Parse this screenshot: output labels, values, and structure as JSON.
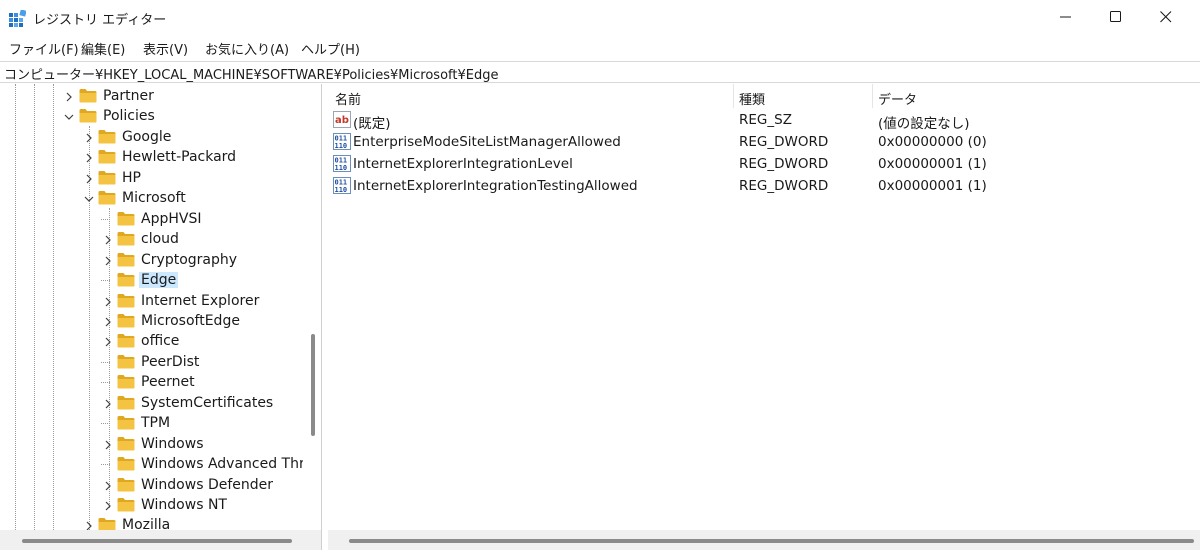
{
  "window": {
    "title": "レジストリ エディター"
  },
  "menu": [
    "ファイル(F)",
    "編集(E)",
    "表示(V)",
    "お気に入り(A)",
    "ヘルプ(H)"
  ],
  "address": "コンピューター¥HKEY_LOCAL_MACHINE¥SOFTWARE¥Policies¥Microsoft¥Edge",
  "tree": [
    {
      "label": "Partner",
      "level": 0,
      "expander": "collapsed"
    },
    {
      "label": "Policies",
      "level": 0,
      "expander": "expanded"
    },
    {
      "label": "Google",
      "level": 1,
      "expander": "collapsed"
    },
    {
      "label": "Hewlett-Packard",
      "level": 1,
      "expander": "collapsed"
    },
    {
      "label": "HP",
      "level": 1,
      "expander": "collapsed"
    },
    {
      "label": "Microsoft",
      "level": 1,
      "expander": "expanded"
    },
    {
      "label": "AppHVSI",
      "level": 2,
      "expander": "none"
    },
    {
      "label": "cloud",
      "level": 2,
      "expander": "collapsed"
    },
    {
      "label": "Cryptography",
      "level": 2,
      "expander": "collapsed"
    },
    {
      "label": "Edge",
      "level": 2,
      "expander": "none",
      "selected": true
    },
    {
      "label": "Internet Explorer",
      "level": 2,
      "expander": "collapsed"
    },
    {
      "label": "MicrosoftEdge",
      "level": 2,
      "expander": "collapsed"
    },
    {
      "label": "office",
      "level": 2,
      "expander": "collapsed"
    },
    {
      "label": "PeerDist",
      "level": 2,
      "expander": "none"
    },
    {
      "label": "Peernet",
      "level": 2,
      "expander": "none"
    },
    {
      "label": "SystemCertificates",
      "level": 2,
      "expander": "collapsed"
    },
    {
      "label": "TPM",
      "level": 2,
      "expander": "none"
    },
    {
      "label": "Windows",
      "level": 2,
      "expander": "collapsed"
    },
    {
      "label": "Windows Advanced Threa",
      "level": 2,
      "expander": "none"
    },
    {
      "label": "Windows Defender",
      "level": 2,
      "expander": "collapsed"
    },
    {
      "label": "Windows NT",
      "level": 2,
      "expander": "collapsed"
    },
    {
      "label": "Mozilla",
      "level": 1,
      "expander": "collapsed"
    }
  ],
  "list": {
    "columns": [
      "名前",
      "種類",
      "データ"
    ],
    "rows": [
      {
        "icon": "string-value-icon",
        "name": "(既定)",
        "type": "REG_SZ",
        "data": "(値の設定なし)"
      },
      {
        "icon": "binary-value-icon",
        "name": "EnterpriseModeSiteListManagerAllowed",
        "type": "REG_DWORD",
        "data": "0x00000000 (0)"
      },
      {
        "icon": "binary-value-icon",
        "name": "InternetExplorerIntegrationLevel",
        "type": "REG_DWORD",
        "data": "0x00000001 (1)"
      },
      {
        "icon": "binary-value-icon",
        "name": "InternetExplorerIntegrationTestingAllowed",
        "type": "REG_DWORD",
        "data": "0x00000001 (1)"
      }
    ]
  },
  "colors": {
    "selection": "#cce8ff",
    "folder": "#f5c342",
    "folder_dark": "#e0a820",
    "accent": "#0078d4"
  }
}
